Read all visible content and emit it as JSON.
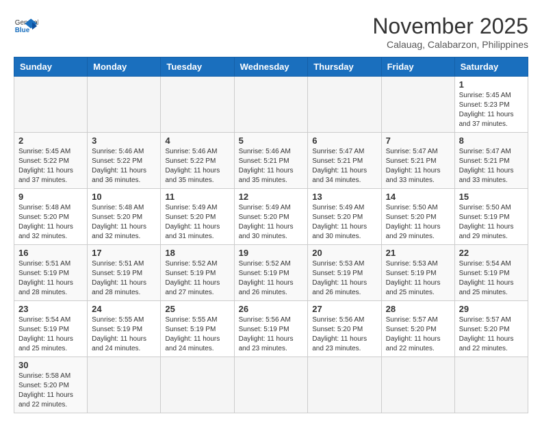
{
  "header": {
    "logo_general": "General",
    "logo_blue": "Blue",
    "month_title": "November 2025",
    "location": "Calauag, Calabarzon, Philippines"
  },
  "days_of_week": [
    "Sunday",
    "Monday",
    "Tuesday",
    "Wednesday",
    "Thursday",
    "Friday",
    "Saturday"
  ],
  "weeks": [
    [
      {
        "day": "",
        "empty": true
      },
      {
        "day": "",
        "empty": true
      },
      {
        "day": "",
        "empty": true
      },
      {
        "day": "",
        "empty": true
      },
      {
        "day": "",
        "empty": true
      },
      {
        "day": "",
        "empty": true
      },
      {
        "day": "1",
        "sunrise": "5:45 AM",
        "sunset": "5:23 PM",
        "daylight": "11 hours and 37 minutes."
      }
    ],
    [
      {
        "day": "2",
        "sunrise": "5:45 AM",
        "sunset": "5:22 PM",
        "daylight": "11 hours and 37 minutes."
      },
      {
        "day": "3",
        "sunrise": "5:46 AM",
        "sunset": "5:22 PM",
        "daylight": "11 hours and 36 minutes."
      },
      {
        "day": "4",
        "sunrise": "5:46 AM",
        "sunset": "5:22 PM",
        "daylight": "11 hours and 35 minutes."
      },
      {
        "day": "5",
        "sunrise": "5:46 AM",
        "sunset": "5:21 PM",
        "daylight": "11 hours and 35 minutes."
      },
      {
        "day": "6",
        "sunrise": "5:47 AM",
        "sunset": "5:21 PM",
        "daylight": "11 hours and 34 minutes."
      },
      {
        "day": "7",
        "sunrise": "5:47 AM",
        "sunset": "5:21 PM",
        "daylight": "11 hours and 33 minutes."
      },
      {
        "day": "8",
        "sunrise": "5:47 AM",
        "sunset": "5:21 PM",
        "daylight": "11 hours and 33 minutes."
      }
    ],
    [
      {
        "day": "9",
        "sunrise": "5:48 AM",
        "sunset": "5:20 PM",
        "daylight": "11 hours and 32 minutes."
      },
      {
        "day": "10",
        "sunrise": "5:48 AM",
        "sunset": "5:20 PM",
        "daylight": "11 hours and 32 minutes."
      },
      {
        "day": "11",
        "sunrise": "5:49 AM",
        "sunset": "5:20 PM",
        "daylight": "11 hours and 31 minutes."
      },
      {
        "day": "12",
        "sunrise": "5:49 AM",
        "sunset": "5:20 PM",
        "daylight": "11 hours and 30 minutes."
      },
      {
        "day": "13",
        "sunrise": "5:49 AM",
        "sunset": "5:20 PM",
        "daylight": "11 hours and 30 minutes."
      },
      {
        "day": "14",
        "sunrise": "5:50 AM",
        "sunset": "5:20 PM",
        "daylight": "11 hours and 29 minutes."
      },
      {
        "day": "15",
        "sunrise": "5:50 AM",
        "sunset": "5:19 PM",
        "daylight": "11 hours and 29 minutes."
      }
    ],
    [
      {
        "day": "16",
        "sunrise": "5:51 AM",
        "sunset": "5:19 PM",
        "daylight": "11 hours and 28 minutes."
      },
      {
        "day": "17",
        "sunrise": "5:51 AM",
        "sunset": "5:19 PM",
        "daylight": "11 hours and 28 minutes."
      },
      {
        "day": "18",
        "sunrise": "5:52 AM",
        "sunset": "5:19 PM",
        "daylight": "11 hours and 27 minutes."
      },
      {
        "day": "19",
        "sunrise": "5:52 AM",
        "sunset": "5:19 PM",
        "daylight": "11 hours and 26 minutes."
      },
      {
        "day": "20",
        "sunrise": "5:53 AM",
        "sunset": "5:19 PM",
        "daylight": "11 hours and 26 minutes."
      },
      {
        "day": "21",
        "sunrise": "5:53 AM",
        "sunset": "5:19 PM",
        "daylight": "11 hours and 25 minutes."
      },
      {
        "day": "22",
        "sunrise": "5:54 AM",
        "sunset": "5:19 PM",
        "daylight": "11 hours and 25 minutes."
      }
    ],
    [
      {
        "day": "23",
        "sunrise": "5:54 AM",
        "sunset": "5:19 PM",
        "daylight": "11 hours and 25 minutes."
      },
      {
        "day": "24",
        "sunrise": "5:55 AM",
        "sunset": "5:19 PM",
        "daylight": "11 hours and 24 minutes."
      },
      {
        "day": "25",
        "sunrise": "5:55 AM",
        "sunset": "5:19 PM",
        "daylight": "11 hours and 24 minutes."
      },
      {
        "day": "26",
        "sunrise": "5:56 AM",
        "sunset": "5:19 PM",
        "daylight": "11 hours and 23 minutes."
      },
      {
        "day": "27",
        "sunrise": "5:56 AM",
        "sunset": "5:20 PM",
        "daylight": "11 hours and 23 minutes."
      },
      {
        "day": "28",
        "sunrise": "5:57 AM",
        "sunset": "5:20 PM",
        "daylight": "11 hours and 22 minutes."
      },
      {
        "day": "29",
        "sunrise": "5:57 AM",
        "sunset": "5:20 PM",
        "daylight": "11 hours and 22 minutes."
      }
    ],
    [
      {
        "day": "30",
        "sunrise": "5:58 AM",
        "sunset": "5:20 PM",
        "daylight": "11 hours and 22 minutes."
      },
      {
        "day": "",
        "empty": true
      },
      {
        "day": "",
        "empty": true
      },
      {
        "day": "",
        "empty": true
      },
      {
        "day": "",
        "empty": true
      },
      {
        "day": "",
        "empty": true
      },
      {
        "day": "",
        "empty": true
      }
    ]
  ],
  "labels": {
    "sunrise": "Sunrise:",
    "sunset": "Sunset:",
    "daylight": "Daylight:"
  }
}
